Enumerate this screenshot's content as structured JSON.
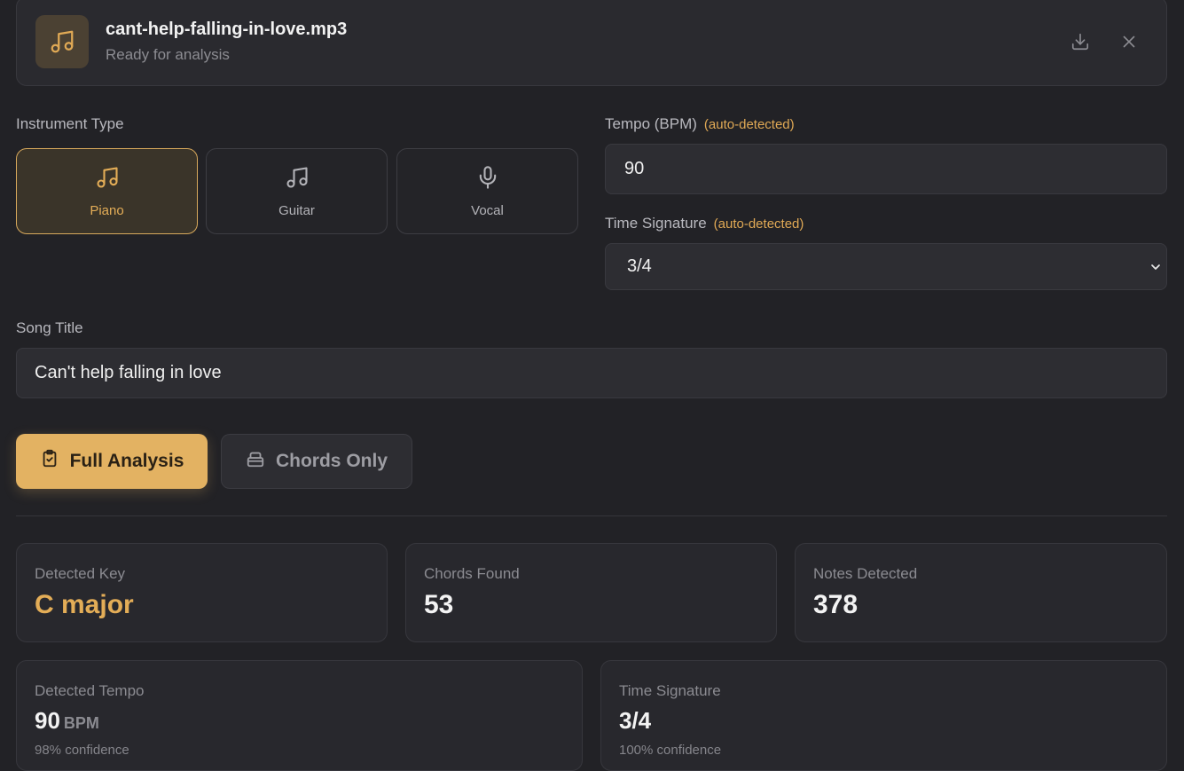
{
  "file": {
    "name": "cant-help-falling-in-love.mp3",
    "status": "Ready for analysis",
    "icon": "music-note-icon"
  },
  "instrument": {
    "label": "Instrument Type",
    "options": [
      {
        "label": "Piano",
        "icon": "music-note-icon",
        "active": true
      },
      {
        "label": "Guitar",
        "icon": "music-note-icon",
        "active": false
      },
      {
        "label": "Vocal",
        "icon": "microphone-icon",
        "active": false
      }
    ]
  },
  "tempo": {
    "label": "Tempo (BPM)",
    "badge": "(auto-detected)",
    "value": "90"
  },
  "time_signature": {
    "label": "Time Signature",
    "badge": "(auto-detected)",
    "value": "3/4"
  },
  "song_title": {
    "label": "Song Title",
    "value": "Can't help falling in love"
  },
  "modes": {
    "full": "Full Analysis",
    "chords": "Chords Only"
  },
  "stats": {
    "key": {
      "label": "Detected Key",
      "value": "C major"
    },
    "chords": {
      "label": "Chords Found",
      "value": "53"
    },
    "notes": {
      "label": "Notes Detected",
      "value": "378"
    },
    "tempo": {
      "label": "Detected Tempo",
      "value": "90",
      "unit": "BPM",
      "confidence": "98% confidence"
    },
    "time_signature": {
      "label": "Time Signature",
      "value": "3/4",
      "confidence": "100% confidence"
    }
  },
  "colors": {
    "accent": "#e3b262",
    "background": "#222226"
  }
}
